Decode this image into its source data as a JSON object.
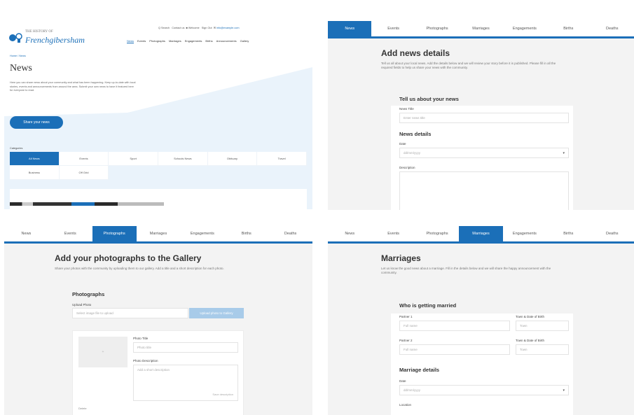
{
  "brand": {
    "colors": {
      "accent": "#1b6fb8",
      "accent_light": "#a8cbe9",
      "hero_bg": "#eaf3fb",
      "page_bg": "#f3f3f3"
    }
  },
  "panel1": {
    "logo": {
      "top_line": "THE HISTORY OF",
      "main_line": "Frenchgibersham"
    },
    "utility": {
      "search": "Q Search",
      "contact": "Contact us",
      "account": "Welcome",
      "signout": "Sign Out",
      "email": "info@example.com"
    },
    "nav": [
      "News",
      "Events",
      "Photographs",
      "Marriages",
      "Engagements",
      "Births",
      "Announcements",
      "Gallery"
    ],
    "breadcrumb": "Home / News",
    "title": "News",
    "intro": "Here you can share news about your community and what has been happening. Keep up-to-date with local stories, events and announcements from around the area. Submit your own news to have it featured here for everyone to read.",
    "cta_label": "Share your news",
    "categories_label": "Categories",
    "categories": [
      "All News",
      "Events",
      "Sport",
      "Schools News",
      "Obituary",
      "Travel",
      "Business",
      "Off Grid"
    ]
  },
  "panel2": {
    "tabs": [
      "News",
      "Events",
      "Photographs",
      "Marriages",
      "Engagements",
      "Births",
      "Deaths"
    ],
    "active_tab": 0,
    "title": "Add news details",
    "intro": "Tell us all about your local news. Add the details below and we will review your story before it is published. Please fill in all the required fields to help us share your news with the community.",
    "section_about": "Tell us about your news",
    "label_title": "News Title",
    "placeholder_title": "Enter news title",
    "section_details": "News details",
    "label_date": "Date",
    "select_date": "dd/mm/yyyy",
    "label_description": "Description"
  },
  "panel3": {
    "tabs": [
      "News",
      "Events",
      "Photographs",
      "Marriages",
      "Engagements",
      "Births",
      "Deaths"
    ],
    "active_tab": 2,
    "title": "Add your photographs to the Gallery",
    "intro": "Share your photos with the community by uploading them to our gallery. Add a title and a short description for each photo.",
    "section": "Photographs",
    "label_upload": "Upload Photo",
    "placeholder_upload": "Select image file to upload",
    "upload_button": "Upload photo to Gallery",
    "thumb_text": "+",
    "label_photo_title": "Photo Title",
    "placeholder_photo_title": "Photo title",
    "label_photo_desc": "Photo Description",
    "placeholder_photo_desc": "Add a short description",
    "small_button": "Save description",
    "delete": "Delete"
  },
  "panel4": {
    "tabs": [
      "News",
      "Events",
      "Photographs",
      "Marriages",
      "Engagements",
      "Births",
      "Deaths"
    ],
    "active_tab": 3,
    "title": "Marriages",
    "intro": "Let us know the good news about a marriage. Fill in the details below and we will share the happy announcement with the community.",
    "section_who": "Who is getting married",
    "partner1_label": "Partner 1",
    "partner1_placeholder": "Full name",
    "location1_label": "Town & Date of Birth",
    "location1_placeholder": "Town",
    "partner2_label": "Partner 2",
    "partner2_placeholder": "Full name",
    "location2_label": "Town & Date of Birth",
    "location2_placeholder": "Town",
    "section_details": "Marriage details",
    "label_date": "Date",
    "select_date": "dd/mm/yyyy",
    "label_location": "Location"
  }
}
